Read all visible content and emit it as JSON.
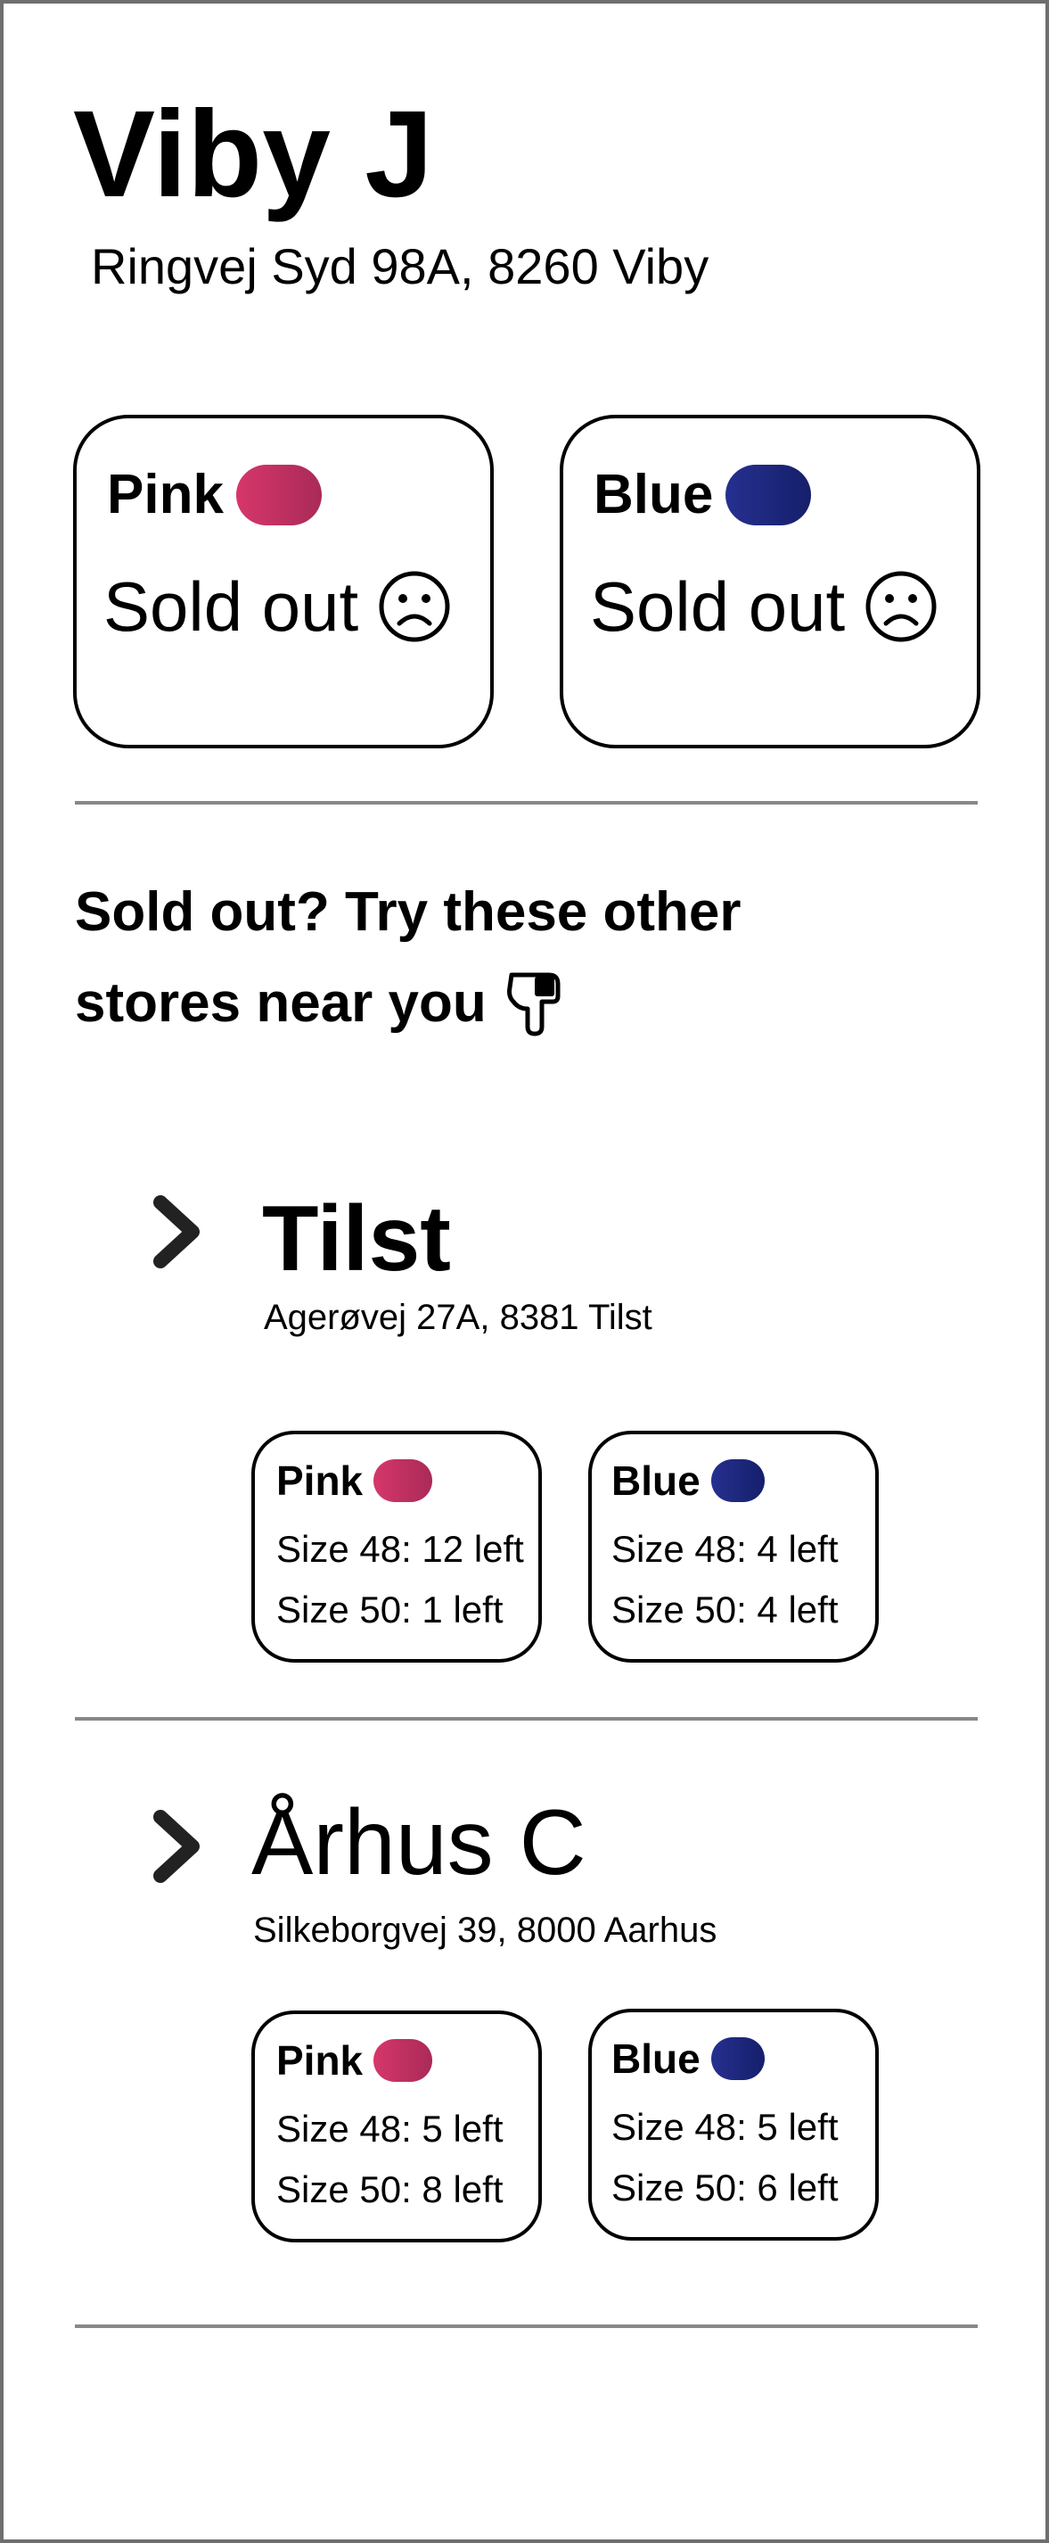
{
  "store": {
    "name": "Viby J",
    "address": "Ringvej Syd 98A, 8260 Viby",
    "stock": [
      {
        "color": "Pink",
        "swatch": "#c8305f",
        "status": "Sold out",
        "status_icon": "sad-face-icon"
      },
      {
        "color": "Blue",
        "swatch": "#1d2880",
        "status": "Sold out",
        "status_icon": "sad-face-icon"
      }
    ]
  },
  "suggestion": {
    "line1": "Sold out? Try these other",
    "line2": "stores near you",
    "icon": "pointing-down-hand-icon"
  },
  "nearby_stores": [
    {
      "name": "Tilst",
      "address": "Agerøvej 27A, 8381 Tilst",
      "expand_icon": "chevron-right-icon",
      "stock": [
        {
          "color": "Pink",
          "swatch": "#c8305f",
          "sizes": [
            "Size 48: 12 left",
            "Size 50: 1 left"
          ]
        },
        {
          "color": "Blue",
          "swatch": "#1d2880",
          "sizes": [
            "Size 48: 4 left",
            "Size 50: 4 left"
          ]
        }
      ]
    },
    {
      "name": "Århus C",
      "address": "Silkeborgvej 39, 8000 Aarhus",
      "expand_icon": "chevron-right-icon",
      "stock": [
        {
          "color": "Pink",
          "swatch": "#c8305f",
          "sizes": [
            "Size 48: 5 left",
            "Size 50: 8 left"
          ]
        },
        {
          "color": "Blue",
          "swatch": "#1d2880",
          "sizes": [
            "Size 48: 5 left",
            "Size 50: 6 left"
          ]
        }
      ]
    }
  ]
}
